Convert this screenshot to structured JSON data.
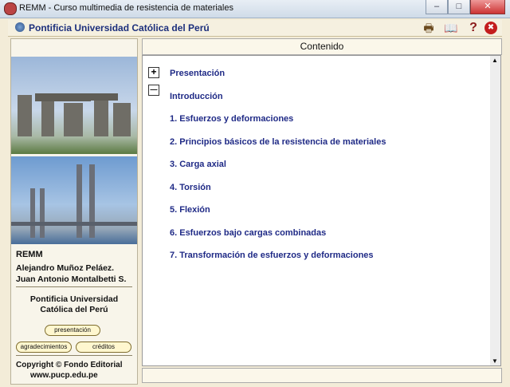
{
  "window": {
    "title": "REMM - Curso multimedia de resistencia de materiales",
    "minimize_glyph": "–",
    "maximize_glyph": "□",
    "close_glyph": "✕"
  },
  "header": {
    "institution": "Pontificia Universidad Católica del Perú"
  },
  "icons": {
    "printer": "printer-icon",
    "book": "book-icon",
    "help": "help-icon",
    "exit": "exit-icon",
    "help_glyph": "?",
    "exit_glyph": "✖",
    "printer_glyph": "🖶",
    "book_glyph": "📖"
  },
  "sidebar": {
    "remm": "REMM",
    "author1": "Alejandro Muñoz Peláez.",
    "author2": "Juan Antonio Montalbetti S.",
    "university_line1": "Pontificia Universidad",
    "university_line2": "Católica del Perú",
    "btn_presentacion": "presentación",
    "btn_agradecimientos": "agradecimientos",
    "btn_creditos": "créditos",
    "copyright": "Copyright © Fondo Editorial",
    "website": "www.pucp.edu.pe"
  },
  "content": {
    "title": "Contenido",
    "expand_glyph": "+",
    "collapse_glyph": "—",
    "items": [
      "Presentación",
      "Introducción",
      "1. Esfuerzos y deformaciones",
      "2. Principios básicos de la resistencia de materiales",
      "3. Carga axial",
      "4. Torsión",
      "5. Flexión",
      "6. Esfuerzos bajo cargas combinadas",
      "7. Transformación de esfuerzos y deformaciones"
    ],
    "scroll_up": "▲",
    "scroll_down": "▼"
  },
  "colors": {
    "accent": "#1f2a86",
    "panel_bg": "#f3ecd8"
  }
}
